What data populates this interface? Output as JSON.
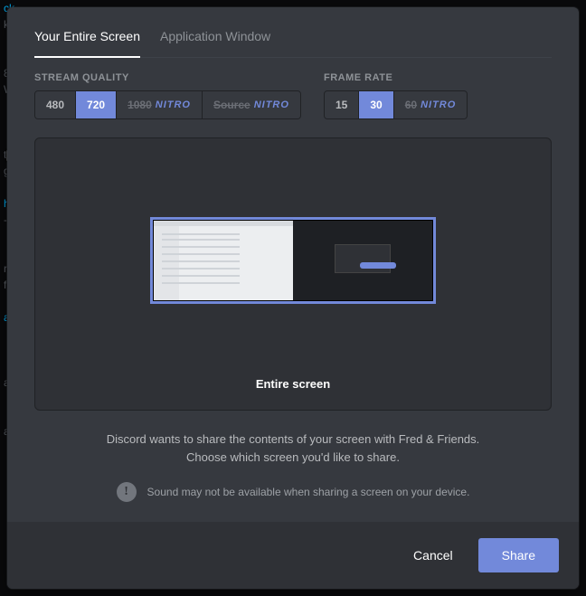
{
  "tabs": {
    "entire_screen": "Your Entire Screen",
    "app_window": "Application Window"
  },
  "quality": {
    "label": "STREAM QUALITY",
    "options": [
      "480",
      "720",
      "1080",
      "Source"
    ],
    "selected": "720",
    "nitro_badge": "NITRO"
  },
  "fps": {
    "label": "FRAME RATE",
    "options": [
      "15",
      "30",
      "60"
    ],
    "selected": "30",
    "nitro_badge": "NITRO"
  },
  "preview": {
    "label": "Entire screen"
  },
  "help": {
    "line1": "Discord wants to share the contents of your screen with Fred & Friends.",
    "line2": "Choose which screen you'd like to share."
  },
  "warning": "Sound may not be available when sharing a screen on your device.",
  "footer": {
    "cancel": "Cancel",
    "share": "Share"
  }
}
